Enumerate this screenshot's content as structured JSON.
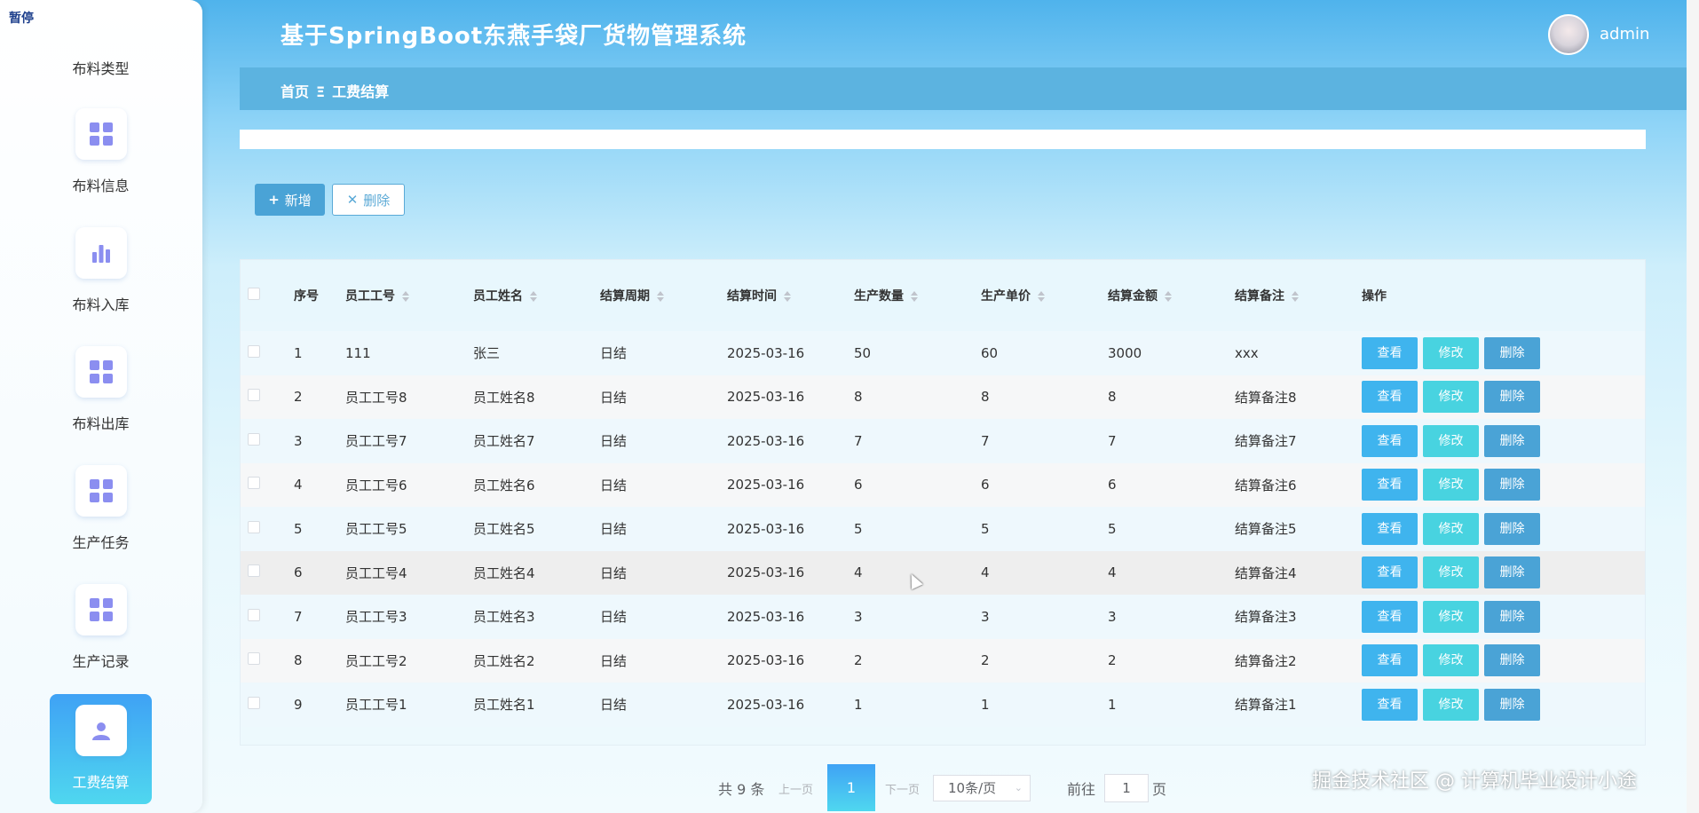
{
  "sidebar": {
    "top_label": "暂停",
    "first_label": "布料类型",
    "items": [
      {
        "label": "布料信息",
        "icon": "grid-icon"
      },
      {
        "label": "布料入库",
        "icon": "bar-chart-icon"
      },
      {
        "label": "布料出库",
        "icon": "grid-icon"
      },
      {
        "label": "生产任务",
        "icon": "grid-icon"
      },
      {
        "label": "生产记录",
        "icon": "grid-icon"
      },
      {
        "label": "工费结算",
        "icon": "user-icon",
        "active": true
      }
    ]
  },
  "header": {
    "title": "基于SpringBoot东燕手袋厂货物管理系统",
    "user": "admin"
  },
  "breadcrumb": {
    "home": "首页",
    "sep": "Ξ",
    "current": "工费结算"
  },
  "toolbar": {
    "add_label": "新增",
    "delete_label": "删除"
  },
  "table": {
    "headers": [
      "序号",
      "员工工号",
      "员工姓名",
      "结算周期",
      "结算时间",
      "生产数量",
      "生产单价",
      "结算金额",
      "结算备注",
      "操作"
    ],
    "rows": [
      [
        "1",
        "111",
        "张三",
        "日结",
        "2025-03-16",
        "50",
        "60",
        "3000",
        "xxx"
      ],
      [
        "2",
        "员工工号8",
        "员工姓名8",
        "日结",
        "2025-03-16",
        "8",
        "8",
        "8",
        "结算备注8"
      ],
      [
        "3",
        "员工工号7",
        "员工姓名7",
        "日结",
        "2025-03-16",
        "7",
        "7",
        "7",
        "结算备注7"
      ],
      [
        "4",
        "员工工号6",
        "员工姓名6",
        "日结",
        "2025-03-16",
        "6",
        "6",
        "6",
        "结算备注6"
      ],
      [
        "5",
        "员工工号5",
        "员工姓名5",
        "日结",
        "2025-03-16",
        "5",
        "5",
        "5",
        "结算备注5"
      ],
      [
        "6",
        "员工工号4",
        "员工姓名4",
        "日结",
        "2025-03-16",
        "4",
        "4",
        "4",
        "结算备注4"
      ],
      [
        "7",
        "员工工号3",
        "员工姓名3",
        "日结",
        "2025-03-16",
        "3",
        "3",
        "3",
        "结算备注3"
      ],
      [
        "8",
        "员工工号2",
        "员工姓名2",
        "日结",
        "2025-03-16",
        "2",
        "2",
        "2",
        "结算备注2"
      ],
      [
        "9",
        "员工工号1",
        "员工姓名1",
        "日结",
        "2025-03-16",
        "1",
        "1",
        "1",
        "结算备注1"
      ]
    ],
    "actions": {
      "view": "查看",
      "edit": "修改",
      "delete": "删除"
    }
  },
  "pagination": {
    "total": "共 9 条",
    "prev": "上一页",
    "current": "1",
    "next": "下一页",
    "page_size": "10条/页",
    "goto": "前往",
    "goto_value": "1",
    "page_word": "页"
  },
  "watermark": "掘金技术社区 @ 计算机毕业设计小途"
}
